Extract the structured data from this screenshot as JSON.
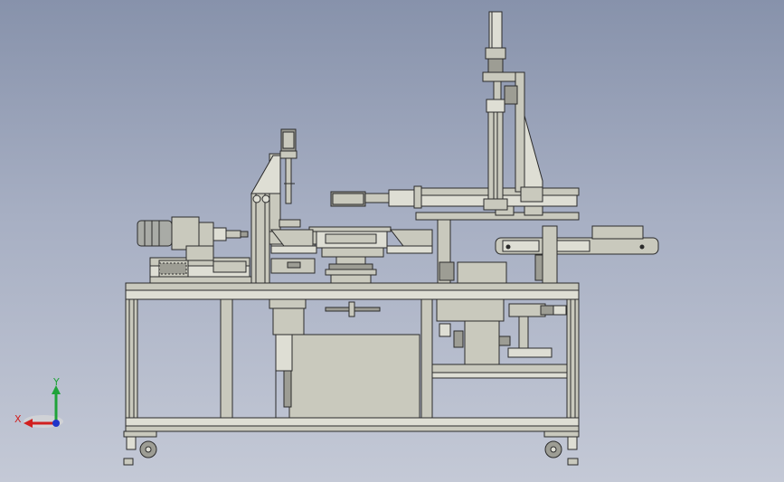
{
  "viewport": {
    "background_top": "#8792ab",
    "background_bottom": "#c4c9d6"
  },
  "colors": {
    "part_fill": "#c9c9bd",
    "part_fill_dark": "#9d9d94",
    "part_fill_light": "#deded4",
    "motor_fill": "#a9aba6",
    "edge": "#2b2b2b",
    "axis_x": "#d11f1f",
    "axis_y": "#1fa339",
    "axis_z": "#1f34c9",
    "triad_shadow": "#d8d8d8"
  },
  "triad": {
    "x_label": "X",
    "y_label": "Y"
  },
  "model": {
    "view": "front",
    "assemblies": [
      "frame-table",
      "spindle-motor-slide",
      "vertical-probe-post",
      "rotary-index-table",
      "pneumatic-gantry",
      "tall-cylinder-column",
      "output-conveyor",
      "electrical-cabinet",
      "caster-wheels"
    ]
  }
}
